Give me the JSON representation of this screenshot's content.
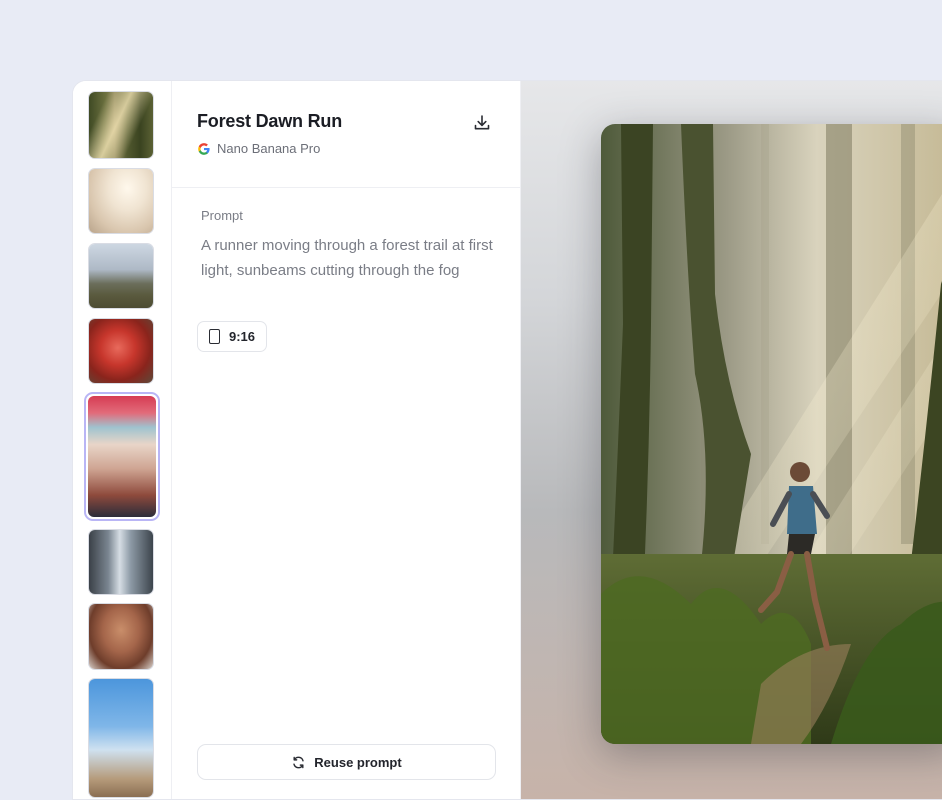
{
  "item": {
    "title": "Forest Dawn Run",
    "model": "Nano Banana Pro",
    "model_icon": "google-g-icon"
  },
  "prompt": {
    "label": "Prompt",
    "text": "A runner moving through a forest trail at first light, sunbeams cutting through the fog",
    "aspect_ratio": "9:16"
  },
  "actions": {
    "reuse_label": "Reuse prompt",
    "download_icon": "download-icon",
    "reuse_icon": "refresh-icon"
  },
  "thumbnails": {
    "count": 8,
    "selected_index": 5
  },
  "colors": {
    "background": "#e8ebf5",
    "selected_ring": "#b9b5f5",
    "text_primary": "#1b1d24",
    "text_muted": "#7a7d86"
  }
}
